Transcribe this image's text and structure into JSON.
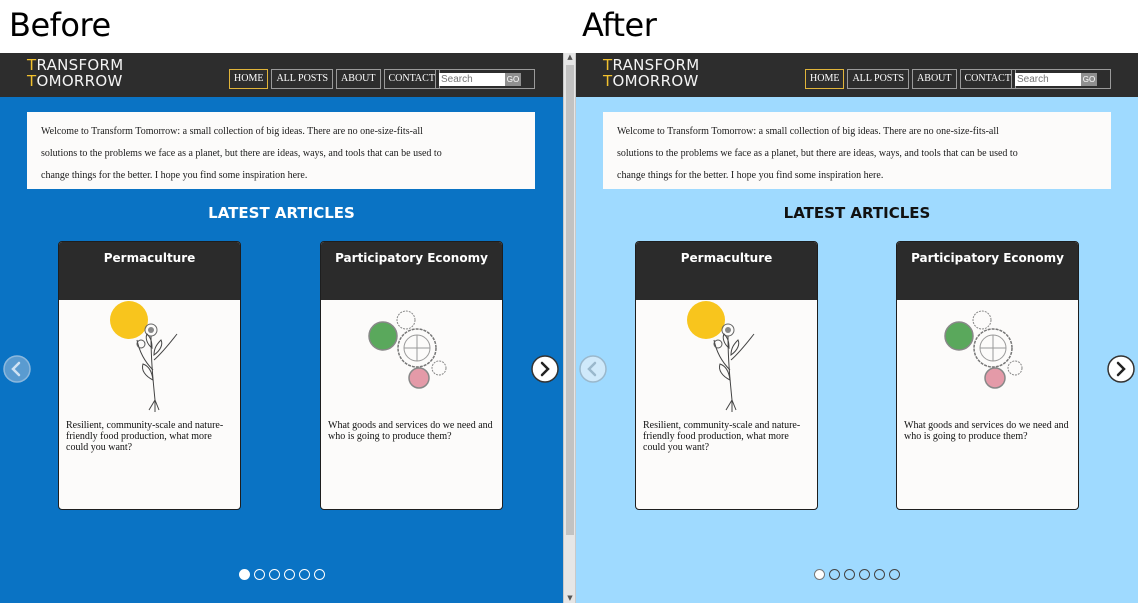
{
  "captions": {
    "before": "Before",
    "after": "After"
  },
  "colors": {
    "before_bg": "#0a73c4",
    "after_bg": "#9fdaff",
    "header": "#2d2d2d",
    "logo_accent": "#f2c12e"
  },
  "logo": {
    "line1_first": "T",
    "line1_rest": "RANSFORM",
    "line2_first": "T",
    "line2_rest": "OMORROW"
  },
  "nav": [
    "HOME",
    "ALL POSTS",
    "ABOUT",
    "CONTACT"
  ],
  "search": {
    "placeholder": "Search",
    "button": "GO"
  },
  "welcome": {
    "line1": "Welcome to Transform Tomorrow: a small collection of big ideas. There are no one-size-fits-all",
    "line2": "solutions to the problems we face as a planet, but there are ideas, ways, and tools that can be used to",
    "line3": "change things for the better. I hope you find some inspiration here."
  },
  "latest_heading": "LATEST ARTICLES",
  "cards": [
    {
      "title": "Permaculture",
      "text": "Resilient, community-scale and nature-friendly food production, what more could you want?",
      "art": "plant-illustration"
    },
    {
      "title": "Participatory Economy",
      "text": "What goods and services do we need and who is going to produce them?",
      "art": "gears-illustration"
    }
  ],
  "carousel": {
    "pages": 6,
    "current": 1
  }
}
